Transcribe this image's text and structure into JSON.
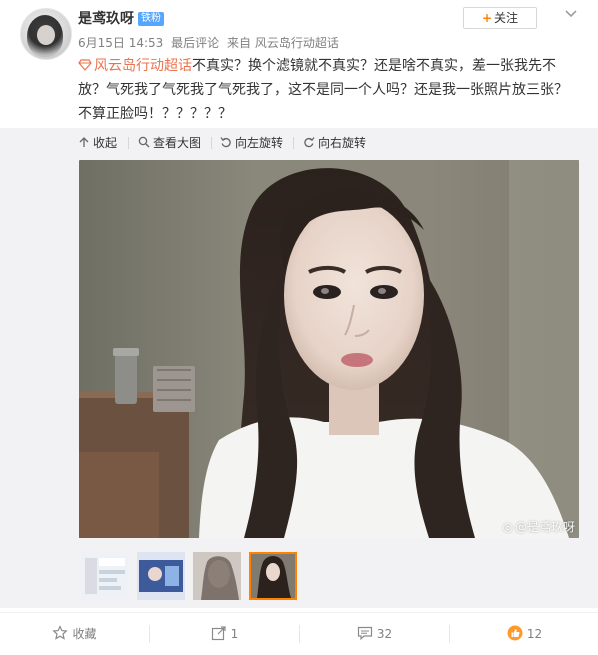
{
  "header": {
    "username": "是鸢玖呀",
    "fan_badge": "铁粉",
    "follow_label": "关注",
    "date": "6月15日 14:53",
    "status": "最后评论",
    "source_prefix": "来自",
    "source": "风云岛行动超话"
  },
  "post": {
    "topic": "风云岛行动超话",
    "text": "不真实？换个滤镜就不真实？还是啥不真实，差一张我先不放？气死我了气死我了气死我了，这不是同一个人吗？还是我一张照片放三张？不算正脸吗！？？？？？"
  },
  "tools": {
    "collapse": "收起",
    "view_large": "查看大图",
    "rotate_left": "向左旋转",
    "rotate_right": "向右旋转"
  },
  "image": {
    "watermark": "@是鸢玖呀"
  },
  "thumbnails": [
    {
      "label": "thumbnail-1",
      "active": false
    },
    {
      "label": "thumbnail-2",
      "active": false
    },
    {
      "label": "thumbnail-3",
      "active": false
    },
    {
      "label": "thumbnail-4",
      "active": true
    }
  ],
  "footer": {
    "favorite": "收藏",
    "repost_count": "1",
    "comment_count": "32",
    "like_count": "12"
  },
  "colors": {
    "topic_accent": "#eb7350",
    "follow_plus": "#ff8200",
    "badge_blue": "#55a6ff",
    "active_thumb_border": "#ff8200",
    "tool_bar_bg": "#f2f2f5"
  },
  "icons": {
    "menu": "chevron-down-icon",
    "topic": "diamond-icon",
    "collapse": "arrow-up-icon",
    "view_large": "magnifier-icon",
    "rotate_left": "rotate-left-icon",
    "rotate_right": "rotate-right-icon",
    "favorite": "star-icon",
    "repost": "share-icon",
    "comment": "comment-icon",
    "like": "thumb-up-icon"
  }
}
